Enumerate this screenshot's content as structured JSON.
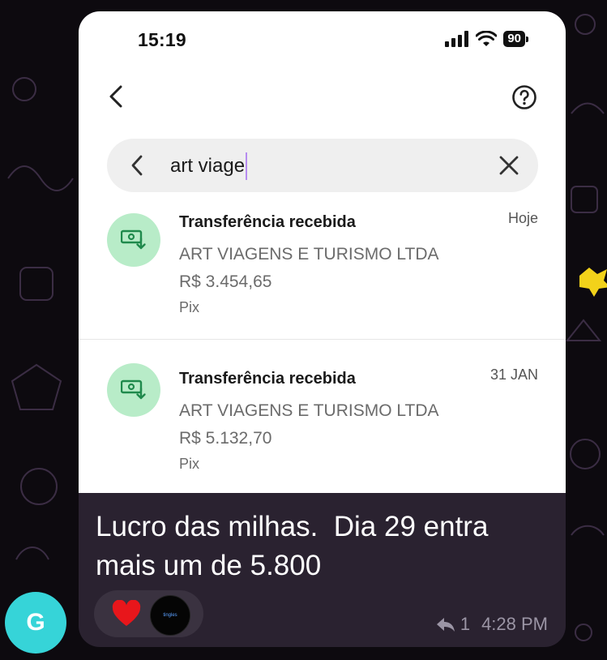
{
  "status_bar": {
    "time": "15:19",
    "battery": "90",
    "signal_icon": "cellular-signal-icon",
    "wifi_icon": "wifi-icon"
  },
  "screenshot": {
    "back_icon": "chevron-left-icon",
    "help_icon": "question-circle-icon",
    "search": {
      "value": "art viage",
      "back_icon": "chevron-left-icon",
      "clear_icon": "close-icon"
    },
    "transactions": [
      {
        "title": "Transferência recebida",
        "date": "Hoje",
        "counterparty": "ART VIAGENS E TURISMO LTDA",
        "amount": "R$ 3.454,65",
        "method": "Pix",
        "icon": "money-receive-icon"
      },
      {
        "title": "Transferência recebida",
        "date": "31 JAN",
        "counterparty": "ART VIAGENS E TURISMO LTDA",
        "amount": "R$ 5.132,70",
        "method": "Pix",
        "icon": "money-receive-icon"
      }
    ]
  },
  "message": {
    "caption": "Lucro das milhas.  Dia 29 entra\nmais um de 5.800",
    "reactions": {
      "emoji": "heart-icon",
      "reactor_avatar_text": "tingles"
    },
    "reply_icon": "reply-arrow-icon",
    "reply_count": "1",
    "time": "4:28 PM"
  },
  "sender": {
    "initial": "G",
    "avatar_color": "#36d4d8"
  },
  "colors": {
    "icon_bg": "#b8ecc8",
    "icon_fg": "#1f8a4c",
    "caret": "#b68cf0",
    "bubble": "#2a2230"
  }
}
